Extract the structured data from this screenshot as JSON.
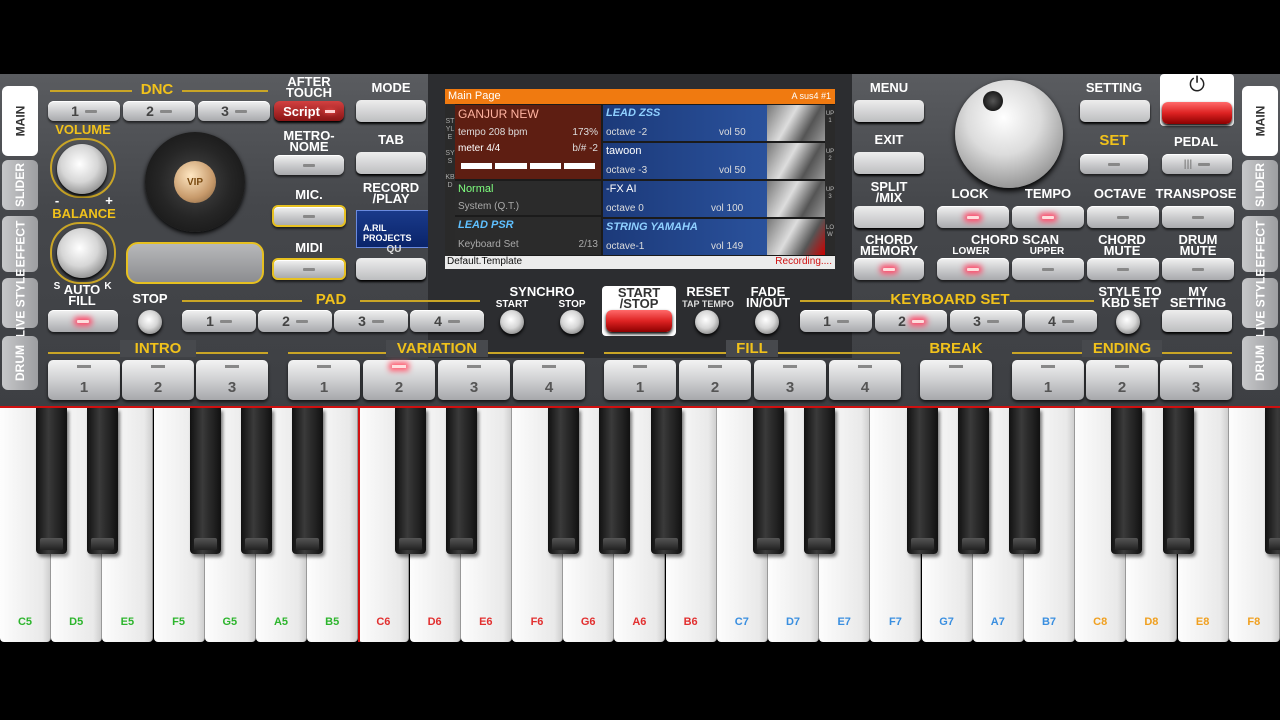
{
  "side_left": [
    "MAIN",
    "SLIDER",
    "EFFECT",
    "LIVE STYLE",
    "DRUM"
  ],
  "side_right": [
    "MAIN",
    "SLIDER",
    "EFFECT",
    "LIVE STYLE",
    "DRUM"
  ],
  "dnc": {
    "title": "DNC",
    "buttons": [
      "1",
      "2",
      "3"
    ],
    "script": "Script"
  },
  "aftertouch": "AFTER\nTOUCH",
  "metronome": "METRO-\nNOME",
  "mic": "MIC.",
  "midi": "MIDI",
  "volume": "VOLUME",
  "balance": "BALANCE",
  "balance_s": "S",
  "balance_k": "K",
  "vol_minus": "-",
  "vol_plus": "+",
  "vip_logo": "VIP",
  "left_col": {
    "mode": "MODE",
    "tab": "TAB",
    "record": "RECORD\n/PLAY",
    "qu": "QU"
  },
  "right_col": {
    "menu": "MENU",
    "exit": "EXIT",
    "split": "SPLIT\n/MIX",
    "chord_memory": "CHORD\nMEMORY"
  },
  "setting": "SETTING",
  "set": "SET",
  "pedal": "PEDAL",
  "power_icon": "⏻",
  "lock": "LOCK",
  "tempo": "TEMPO",
  "octave": "OCTAVE",
  "transpose": "TRANSPOSE",
  "chord_scan": "CHORD SCAN",
  "lower": "LOWER",
  "upper": "UPPER",
  "chord_mute": "CHORD\nMUTE",
  "drum_mute": "DRUM\nMUTE",
  "lcd": {
    "header": "Main Page",
    "header_right": "A sus4 #1",
    "style_name": "GANJUR NEW",
    "tempo": "tempo 208 bpm",
    "tempo_pct": "173%",
    "meter": "meter 4/4",
    "bpm_shift": "b/# -2",
    "perf": "Normal",
    "perf_sub": "System (Q.T.)",
    "kbd": "LEAD PSR",
    "kbd_sub": "Keyboard Set",
    "kbd_num": "2/13",
    "left_letters_1": "STYLE",
    "left_letters_2": "SYS",
    "left_letters_3": "KBD",
    "footer_left": "Default.Template",
    "footer_right": "Recording....",
    "voices": [
      {
        "name": "LEAD ZSS",
        "octave": "octave -2",
        "vol": "vol 50",
        "tag": "UP1"
      },
      {
        "name": "tawoon",
        "octave": "octave -3",
        "vol": "vol 50",
        "tag": "UP2"
      },
      {
        "name": "-FX AI",
        "octave": "octave 0",
        "vol": "vol 100",
        "tag": "UP3"
      },
      {
        "name": "STRING YAMAHA",
        "octave": "octave-1",
        "vol": "vol 149",
        "tag": "LOW"
      }
    ]
  },
  "watermark": "A.RIL PROJECTS",
  "auto_fill": "AUTO\nFILL",
  "stop": "STOP",
  "pad_title": "PAD",
  "pad_buttons": [
    "1",
    "2",
    "3",
    "4"
  ],
  "synchro": "SYNCHRO",
  "synchro_start": "START",
  "synchro_stop": "STOP",
  "start_stop": "START\n/STOP",
  "reset": "RESET",
  "tap_tempo": "TAP TEMPO",
  "fade": "FADE\nIN/OUT",
  "keyboard_set": "KEYBOARD SET",
  "kbd_set_buttons": [
    "1",
    "2",
    "3",
    "4"
  ],
  "style_to_kbd": "STYLE TO\nKBD SET",
  "my_setting": "MY\nSETTING",
  "intro": {
    "title": "INTRO",
    "buttons": [
      "1",
      "2",
      "3"
    ]
  },
  "variation": {
    "title": "VARIATION",
    "buttons": [
      "1",
      "2",
      "3",
      "4"
    ]
  },
  "fill": {
    "title": "FILL",
    "buttons": [
      "1",
      "2",
      "3",
      "4"
    ]
  },
  "break": {
    "title": "BREAK"
  },
  "ending": {
    "title": "ENDING",
    "buttons": [
      "1",
      "2",
      "3"
    ]
  },
  "white_keys": [
    {
      "label": "C5",
      "color": "#2db52d"
    },
    {
      "label": "D5",
      "color": "#2db52d"
    },
    {
      "label": "E5",
      "color": "#2db52d"
    },
    {
      "label": "F5",
      "color": "#2db52d"
    },
    {
      "label": "G5",
      "color": "#2db52d"
    },
    {
      "label": "A5",
      "color": "#2db52d"
    },
    {
      "label": "B5",
      "color": "#2db52d"
    },
    {
      "label": "C6",
      "color": "#e23030"
    },
    {
      "label": "D6",
      "color": "#e23030"
    },
    {
      "label": "E6",
      "color": "#e23030"
    },
    {
      "label": "F6",
      "color": "#e23030"
    },
    {
      "label": "G6",
      "color": "#e23030"
    },
    {
      "label": "A6",
      "color": "#e23030"
    },
    {
      "label": "B6",
      "color": "#e23030"
    },
    {
      "label": "C7",
      "color": "#3a8fe0"
    },
    {
      "label": "D7",
      "color": "#3a8fe0"
    },
    {
      "label": "E7",
      "color": "#3a8fe0"
    },
    {
      "label": "F7",
      "color": "#3a8fe0"
    },
    {
      "label": "G7",
      "color": "#3a8fe0"
    },
    {
      "label": "A7",
      "color": "#3a8fe0"
    },
    {
      "label": "B7",
      "color": "#3a8fe0"
    },
    {
      "label": "C8",
      "color": "#f0a020"
    },
    {
      "label": "D8",
      "color": "#f0a020"
    },
    {
      "label": "E8",
      "color": "#f0a020"
    },
    {
      "label": "F8",
      "color": "#f0a020"
    }
  ],
  "colors": {
    "gold": "#f1c21b",
    "led_red": "#ff4a6a",
    "lcd_orange": "#f07a10",
    "keyboard_line": "#d01010"
  }
}
